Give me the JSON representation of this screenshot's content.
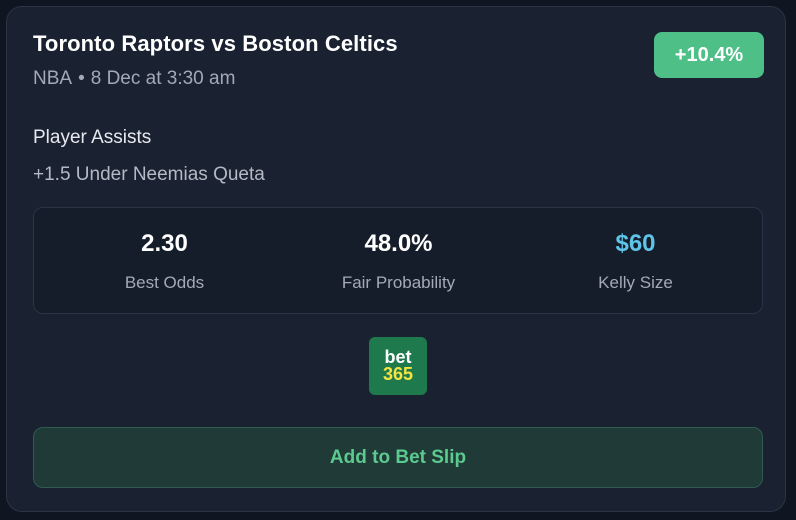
{
  "event": {
    "title": "Toronto Raptors vs Boston Celtics",
    "league": "NBA",
    "separator": "•",
    "datetime": "8 Dec at 3:30 am",
    "edge": "+10.4%"
  },
  "bet": {
    "market": "Player Assists",
    "selection": "+1.5 Under Neemias Queta"
  },
  "stats": [
    {
      "value": "2.30",
      "label": "Best Odds"
    },
    {
      "value": "48.0%",
      "label": "Fair Probability"
    },
    {
      "value": "$60",
      "label": "Kelly Size"
    }
  ],
  "bookmaker": {
    "logo_top": "bet",
    "logo_bottom": "365"
  },
  "actions": {
    "add_label": "Add to Bet Slip"
  },
  "colors": {
    "edge_badge": "#4dbf87",
    "kelly_accent": "#5ec4e8",
    "button_text": "#5cc98f",
    "logo_green": "#1e7a4c",
    "logo_yellow": "#f5e442"
  }
}
